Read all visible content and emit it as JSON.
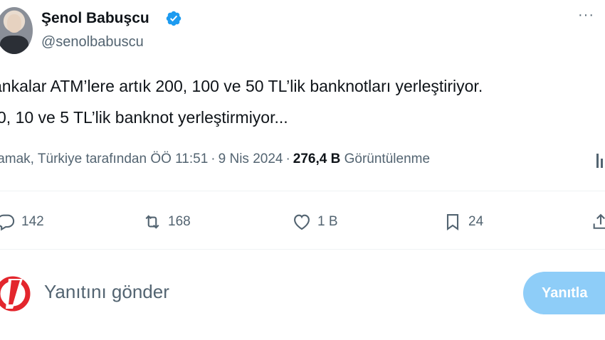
{
  "author": {
    "display_name": "Şenol Babuşcu",
    "handle": "@senolbabuscu",
    "verified": true,
    "verified_color": "#1d9bf0"
  },
  "tweet": {
    "line1": "ankalar ATM’lere artık 200, 100 ve 50 TL’lik banknotları yerleştiriyor.",
    "line2": "0, 10 ve 5 TL’lik banknot yerleştirmiyor..."
  },
  "meta": {
    "translated_by": "lamak, Türkiye tarafından",
    "time": "ÖÖ 11:51",
    "separator": "·",
    "date": "9 Nis 2024",
    "views_count": "276,4 B",
    "views_label": "Görüntülenme"
  },
  "actions": {
    "replies": "142",
    "reposts": "168",
    "likes": "1 B",
    "bookmarks": "24"
  },
  "reply": {
    "placeholder": "Yanıtını gönder",
    "button_label": "Yanıtla",
    "button_color": "#8ecdf8"
  },
  "icons": [
    "verified-icon",
    "more-icon",
    "analytics-icon",
    "reply-icon",
    "repost-icon",
    "like-icon",
    "bookmark-icon",
    "share-icon",
    "brand-logo"
  ]
}
